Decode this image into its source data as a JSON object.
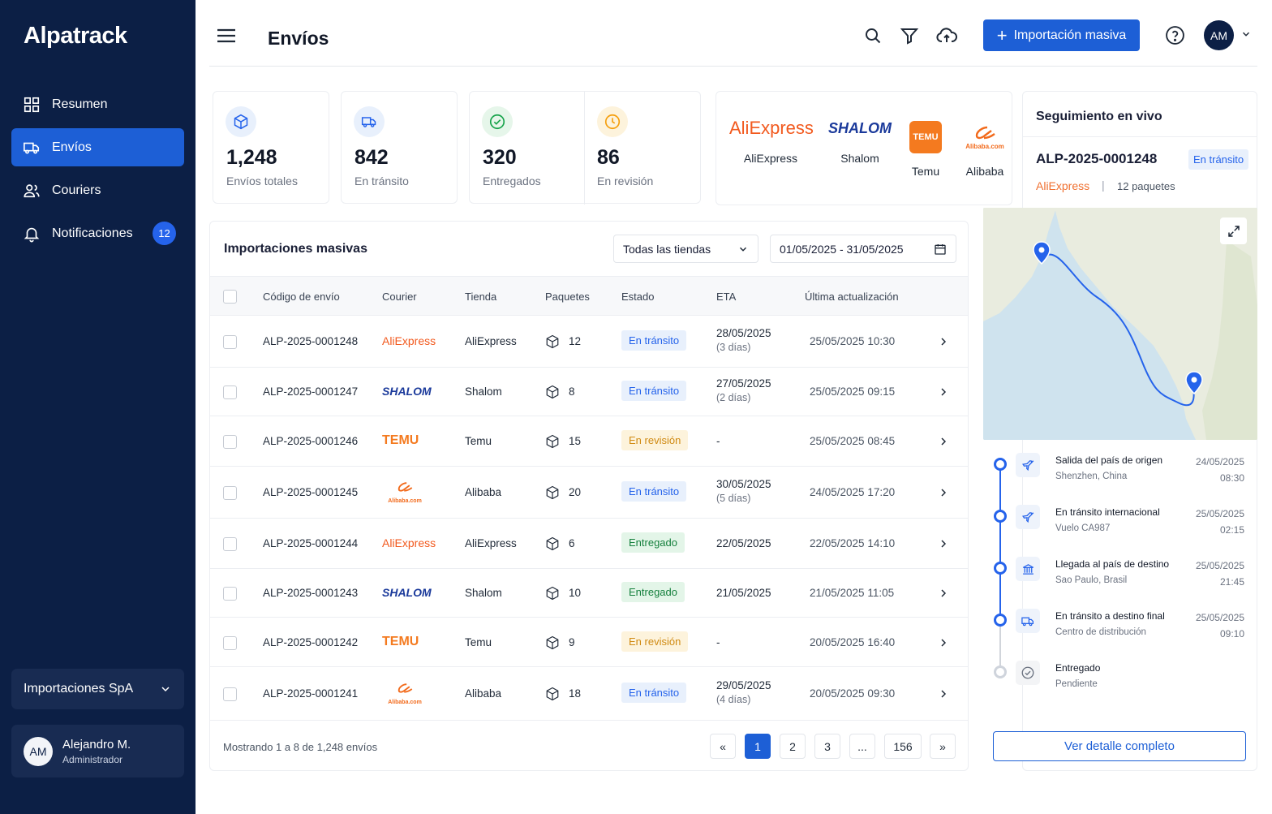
{
  "app": {
    "brand": "Alpatrack",
    "page_title": "Envíos"
  },
  "sidebar": {
    "items": [
      {
        "label": "Resumen",
        "icon": "grid-icon"
      },
      {
        "label": "Envíos",
        "icon": "truck-icon",
        "active": true
      },
      {
        "label": "Couriers",
        "icon": "users-icon"
      },
      {
        "label": "Notificaciones",
        "icon": "bell-icon",
        "badge": "12"
      }
    ],
    "org": "Importaciones SpA",
    "user": {
      "initials": "AM",
      "name": "Alejandro M.",
      "role": "Administrador"
    }
  },
  "header": {
    "import_button": "Importación masiva",
    "avatar_initials": "AM"
  },
  "stats": [
    {
      "value": "1,248",
      "label": "Envíos totales",
      "icon": "box-icon",
      "color": "#2563eb"
    },
    {
      "value": "842",
      "label": "En tránsito",
      "icon": "truck-icon",
      "color": "#2563eb"
    },
    {
      "value": "320",
      "label": "Entregados",
      "icon": "check-circle-icon",
      "color": "#16a34a"
    },
    {
      "value": "86",
      "label": "En revisión",
      "icon": "clock-icon",
      "color": "#f59e0b"
    }
  ],
  "stores": [
    {
      "name": "AliExpress",
      "logo": "AliExpress"
    },
    {
      "name": "Shalom",
      "logo": "SHALOM"
    },
    {
      "name": "Temu",
      "logo": "TEMU"
    },
    {
      "name": "Alibaba",
      "logo": "Alibaba.com"
    }
  ],
  "live": {
    "title": "Seguimiento en vivo",
    "code": "ALP-2025-0001248",
    "status": "En tránsito",
    "store": "AliExpress",
    "separator": "|",
    "packages": "12 paquetes",
    "steps": [
      {
        "title": "Salida del país de origen",
        "sub": "Shenzhen, China",
        "date": "24/05/2025",
        "time": "08:30",
        "icon": "plane-icon"
      },
      {
        "title": "En tránsito internacional",
        "sub": "Vuelo CA987",
        "date": "25/05/2025",
        "time": "02:15",
        "icon": "plane-icon"
      },
      {
        "title": "Llegada al país de destino",
        "sub": "Sao Paulo, Brasil",
        "date": "25/05/2025",
        "time": "21:45",
        "icon": "bank-icon"
      },
      {
        "title": "En tránsito a destino final",
        "sub": "Centro de distribución",
        "date": "25/05/2025",
        "time": "09:10",
        "icon": "truck-icon"
      },
      {
        "title": "Entregado",
        "sub": "Pendiente",
        "date": "",
        "time": "",
        "icon": "check-circle-icon"
      }
    ],
    "detail_button": "Ver detalle completo"
  },
  "table": {
    "title": "Importaciones masivas",
    "filter_store": "Todas las tiendas",
    "date_range": "01/05/2025 - 31/05/2025",
    "columns": [
      "Código de envío",
      "Courier",
      "Tienda",
      "Paquetes",
      "Estado",
      "ETA",
      "Última actualización"
    ],
    "rows": [
      {
        "code": "ALP-2025-0001248",
        "courier": "AliExpress",
        "store": "AliExpress",
        "packages": "12",
        "status": "En tránsito",
        "status_kind": "transit",
        "eta": "28/05/2025",
        "eta_sub": "(3 días)",
        "updated": "25/05/2025 10:30"
      },
      {
        "code": "ALP-2025-0001247",
        "courier": "SHALOM",
        "store": "Shalom",
        "packages": "8",
        "status": "En tránsito",
        "status_kind": "transit",
        "eta": "27/05/2025",
        "eta_sub": "(2 días)",
        "updated": "25/05/2025 09:15"
      },
      {
        "code": "ALP-2025-0001246",
        "courier": "TEMU",
        "store": "Temu",
        "packages": "15",
        "status": "En revisión",
        "status_kind": "review",
        "eta": "-",
        "eta_sub": "",
        "updated": "25/05/2025 08:45"
      },
      {
        "code": "ALP-2025-0001245",
        "courier": "Alibaba.com",
        "store": "Alibaba",
        "packages": "20",
        "status": "En tránsito",
        "status_kind": "transit",
        "eta": "30/05/2025",
        "eta_sub": "(5 días)",
        "updated": "24/05/2025 17:20"
      },
      {
        "code": "ALP-2025-0001244",
        "courier": "AliExpress",
        "store": "AliExpress",
        "packages": "6",
        "status": "Entregado",
        "status_kind": "done",
        "eta": "22/05/2025",
        "eta_sub": "",
        "updated": "22/05/2025 14:10"
      },
      {
        "code": "ALP-2025-0001243",
        "courier": "SHALOM",
        "store": "Shalom",
        "packages": "10",
        "status": "Entregado",
        "status_kind": "done",
        "eta": "21/05/2025",
        "eta_sub": "",
        "updated": "21/05/2025 11:05"
      },
      {
        "code": "ALP-2025-0001242",
        "courier": "TEMU",
        "store": "Temu",
        "packages": "9",
        "status": "En revisión",
        "status_kind": "review",
        "eta": "-",
        "eta_sub": "",
        "updated": "20/05/2025 16:40"
      },
      {
        "code": "ALP-2025-0001241",
        "courier": "Alibaba.com",
        "store": "Alibaba",
        "packages": "18",
        "status": "En tránsito",
        "status_kind": "transit",
        "eta": "29/05/2025",
        "eta_sub": "(4 días)",
        "updated": "20/05/2025 09:30"
      }
    ],
    "footer": "Mostrando 1 a 8 de 1,248 envíos",
    "pages": [
      "«",
      "1",
      "2",
      "3",
      "...",
      "156",
      "»"
    ],
    "current_page": "1"
  },
  "colors": {
    "sidebar": "#0c1f45",
    "accent": "#1d5fd6",
    "aliexpress": "#f25a1f",
    "temu": "#f47a1f",
    "shalom": "#1b3a9b",
    "alibaba": "#f26a1b"
  }
}
